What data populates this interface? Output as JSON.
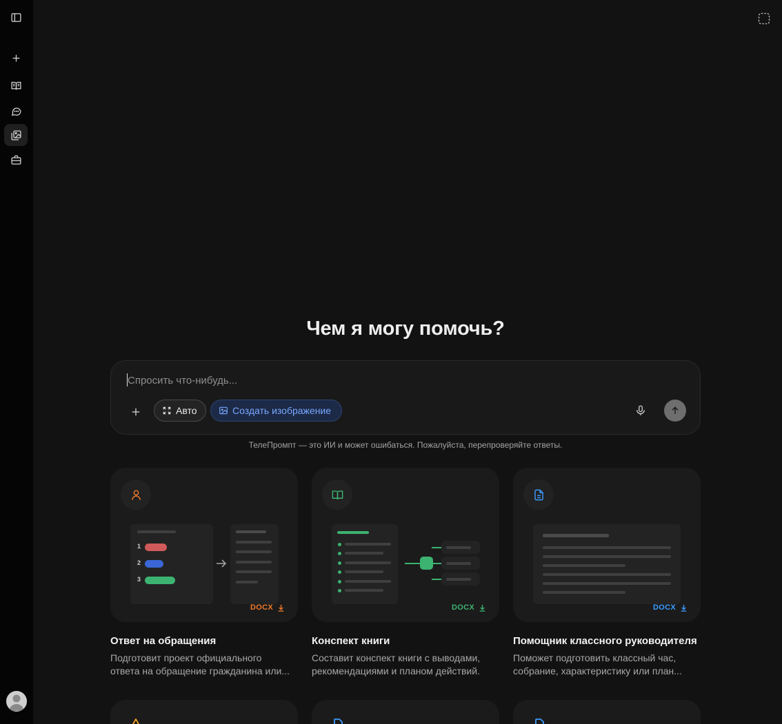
{
  "sidebar": {
    "items": [
      {
        "name": "toggle-sidebar",
        "icon": "panel-left-icon"
      },
      {
        "name": "new-chat",
        "icon": "plus-icon"
      },
      {
        "name": "library",
        "icon": "book-open-icon"
      },
      {
        "name": "chats",
        "icon": "chat-bubble-icon"
      },
      {
        "name": "images",
        "icon": "images-icon",
        "active": true
      },
      {
        "name": "work",
        "icon": "briefcase-icon"
      }
    ],
    "avatar_icon": "user-avatar-icon"
  },
  "header": {
    "corner_icon": "dashed-square-icon"
  },
  "main": {
    "title": "Чем я могу помочь?",
    "composer": {
      "placeholder": "Спросить что-нибудь...",
      "auto_label": "Авто",
      "image_label": "Создать изображение"
    },
    "disclaimer": "ТелеПромпт — это ИИ и может ошибаться. Пожалуйста, перепроверяйте ответы."
  },
  "cards": [
    {
      "title": "Ответ на обращения",
      "desc_line1": "Подготовит проект официального",
      "desc_line2": "ответа на обращение гражданина или...",
      "badge": "DOCX",
      "accent": "#f07a2a",
      "icon": "user-icon",
      "list_numbers": [
        "1",
        "2",
        "3"
      ]
    },
    {
      "title": "Конспект книги",
      "desc_line1": "Составит конспект книги с выводами,",
      "desc_line2": "рекомендациями и планом действий.",
      "badge": "DOCX",
      "accent": "#3cb371",
      "icon": "book-open-icon"
    },
    {
      "title": "Помощник классного руководителя",
      "desc_line1": "Поможет подготовить классный час,",
      "desc_line2": "собрание, характеристику или план...",
      "badge": "DOCX",
      "accent": "#3b9cff",
      "icon": "document-icon"
    }
  ],
  "colors": {
    "red_pill": "#d05a5a",
    "blue_pill": "#3a66d6",
    "green_pill": "#3cb371",
    "link_blue": "#79a7ff"
  }
}
